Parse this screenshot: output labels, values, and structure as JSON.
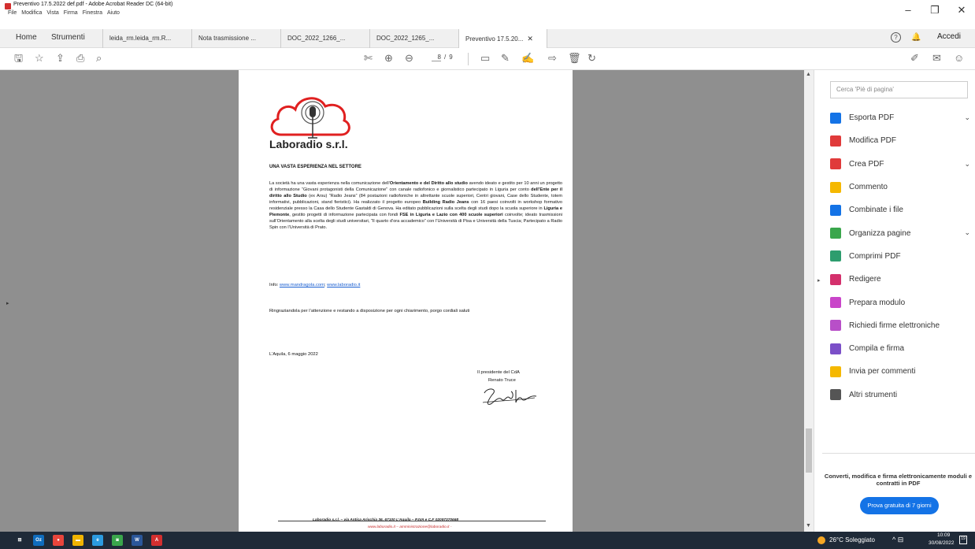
{
  "window": {
    "title": "Preventivo 17.5.2022 def.pdf - Adobe Acrobat Reader DC (64-bit)",
    "menu": [
      "File",
      "Modifica",
      "Vista",
      "Firma",
      "Finestra",
      "Aiuto"
    ],
    "controls": {
      "minimize": "–",
      "maximize": "❐",
      "close": "✕"
    }
  },
  "tabbar": {
    "home": "Home",
    "tools": "Strumenti",
    "tabs": [
      {
        "label": "leida_rm.leida_rm.R..."
      },
      {
        "label": "Nota trasmissione ..."
      },
      {
        "label": "DOC_2022_1266_..."
      },
      {
        "label": "DOC_2022_1265_..."
      },
      {
        "label": "Preventivo 17.5.20..."
      }
    ],
    "help": "?",
    "sign_in": "Accedi"
  },
  "toolbar": {
    "current_page": "8",
    "page_separator": "/",
    "total_pages": "9"
  },
  "document": {
    "brand": "Laboradio s.r.l.",
    "heading": "UNA VASTA ESPERIENZA NEL SETTORE",
    "body": [
      {
        "t": "La società ha una vasta esperienza nella comunicazione dell’",
        "b": false
      },
      {
        "t": "Orientamento e del Diritto allo studio",
        "b": true
      },
      {
        "t": " avendo ideato e gestito per 10 anni un progetto di informazione “Giovani protagonisti della Comunicazione” con canale radiofonico e giornalistico partecipato in Liguria per conto ",
        "b": false
      },
      {
        "t": "dell’Ente per il diritto allo Studio",
        "b": true
      },
      {
        "t": " (ex Arsu) “Radio Jeans” (84 postazioni radiofoniche in altrettante scuole superiori, Centri giovani, Case dello Studente, totem informativi, pubblicazioni, stand fieristici). Ha realizzato il progetto europeo ",
        "b": false
      },
      {
        "t": "Building Radio Jeans",
        "b": true
      },
      {
        "t": " con 16 paesi coinvolti in workshop formativo residenziale presso la Casa dello Studente Gastaldi di Genova. Ha editato pubblicazioni sulla scelta degli studi dopo la scuola superiore in ",
        "b": false
      },
      {
        "t": "Liguria e Piemonte",
        "b": true
      },
      {
        "t": ", gestito progetti di informazione partecipata con fondi ",
        "b": false
      },
      {
        "t": "FSE in Liguria e Lazio con 400 scuole superiori",
        "b": true
      },
      {
        "t": " coinvolte; ideato trasmissioni sull’Orientamento alla scelta degli studi universitari, “Il quarto d’ora accademico” con l’Università di Pisa e Università della Tuscia; Partecipato a Radio Spin con l’Università di Prato.",
        "b": false
      }
    ],
    "info_label": "Info: ",
    "link1": "www.mandragola.com",
    "link_sep": "; ",
    "link2": "www.laboradio.it",
    "thanks": "Ringraziandola per l’attenzione e restando a disposizione per ogni chiarimento, porgo cordiali saluti",
    "place_date": "L’Aquila, 6 maggio 2022",
    "president_title": "Il presidente del CdA",
    "president_name": "Renato Truce",
    "footer_line1": "Laboradio s.r.l. – via Antica Arischia 36, 67100 L’Aquila – P.IVA e C.F 02097370668",
    "footer_line2": "www.laboradio.it – amministrazione@laboradio.it -"
  },
  "right_panel": {
    "search_placeholder": "Cerca 'Piè di pagina'",
    "tools": [
      {
        "label": "Esporta PDF",
        "icon": "export-pdf-icon",
        "color": "#1473e6",
        "chevron": "⌄"
      },
      {
        "label": "Modifica PDF",
        "icon": "edit-pdf-icon",
        "color": "#e03a3a",
        "chevron": ""
      },
      {
        "label": "Crea PDF",
        "icon": "create-pdf-icon",
        "color": "#e03a3a",
        "chevron": "⌄"
      },
      {
        "label": "Commento",
        "icon": "comment-icon",
        "color": "#f5b800",
        "chevron": ""
      },
      {
        "label": "Combinate i file",
        "icon": "combine-files-icon",
        "color": "#1473e6",
        "chevron": ""
      },
      {
        "label": "Organizza pagine",
        "icon": "organize-pages-icon",
        "color": "#3aa64c",
        "chevron": "⌄"
      },
      {
        "label": "Comprimi PDF",
        "icon": "compress-pdf-icon",
        "color": "#2d9d6e",
        "chevron": ""
      },
      {
        "label": "Redigere",
        "icon": "redact-icon",
        "color": "#d4306c",
        "chevron": ""
      },
      {
        "label": "Prepara modulo",
        "icon": "prepare-form-icon",
        "color": "#c945c9",
        "chevron": ""
      },
      {
        "label": "Richiedi firme elettroniche",
        "icon": "request-signatures-icon",
        "color": "#b84fc8",
        "chevron": ""
      },
      {
        "label": "Compila e firma",
        "icon": "fill-sign-icon",
        "color": "#7b4fc8",
        "chevron": ""
      },
      {
        "label": "Invia per commenti",
        "icon": "send-comments-icon",
        "color": "#f5b800",
        "chevron": ""
      },
      {
        "label": "Altri strumenti",
        "icon": "more-tools-icon",
        "color": "#555555",
        "chevron": ""
      }
    ],
    "promo_text": "Converti, modifica e firma elettronicamente moduli e contratti in PDF",
    "trial_button": "Prova gratuita di 7 giorni"
  },
  "taskbar": {
    "apps": [
      {
        "name": "start-icon",
        "label": "⊞",
        "color": "#1f2a38"
      },
      {
        "name": "outlook-icon",
        "label": "Oz",
        "color": "#0f6cbd"
      },
      {
        "name": "chrome-icon",
        "label": "●",
        "color": "#e8453c"
      },
      {
        "name": "file-explorer-icon",
        "label": "▬",
        "color": "#f0b400"
      },
      {
        "name": "edge-icon",
        "label": "e",
        "color": "#2c9be0"
      },
      {
        "name": "app-green-icon",
        "label": "◙",
        "color": "#3aa64c"
      },
      {
        "name": "word-icon",
        "label": "W",
        "color": "#2b579a"
      },
      {
        "name": "acrobat-icon",
        "label": "A",
        "color": "#d32f2f"
      }
    ],
    "weather": "26°C Soleggiato",
    "tray": "^ ⊟",
    "time": "10:09",
    "date": "30/08/2022",
    "notifications": "19"
  }
}
